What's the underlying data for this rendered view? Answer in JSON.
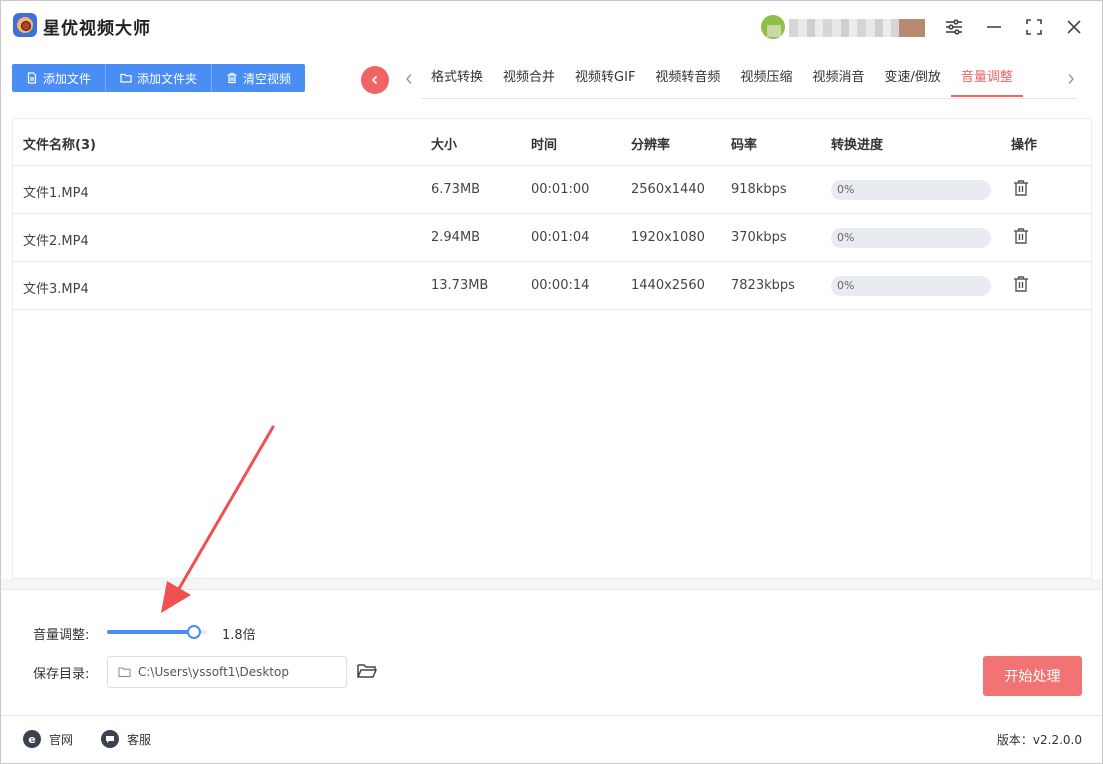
{
  "app": {
    "title": "星优视频大师"
  },
  "toolbar": {
    "add_file": "添加文件",
    "add_folder": "添加文件夹",
    "clear_videos": "清空视频"
  },
  "tabs": [
    {
      "label": "格式转换"
    },
    {
      "label": "视频合并"
    },
    {
      "label": "视频转GIF"
    },
    {
      "label": "视频转音频"
    },
    {
      "label": "视频压缩"
    },
    {
      "label": "视频消音"
    },
    {
      "label": "变速/倒放"
    },
    {
      "label": "音量调整",
      "active": true
    }
  ],
  "table": {
    "headers": {
      "name": "文件名称(3)",
      "size": "大小",
      "duration": "时间",
      "resolution": "分辨率",
      "bitrate": "码率",
      "progress": "转换进度",
      "actions": "操作"
    },
    "rows": [
      {
        "name": "文件1.MP4",
        "size": "6.73MB",
        "duration": "00:01:00",
        "resolution": "2560x1440",
        "bitrate": "918kbps",
        "progress": "0%",
        "progress_value": 0
      },
      {
        "name": "文件2.MP4",
        "size": "2.94MB",
        "duration": "00:01:04",
        "resolution": "1920x1080",
        "bitrate": "370kbps",
        "progress": "0%",
        "progress_value": 0
      },
      {
        "name": "文件3.MP4",
        "size": "13.73MB",
        "duration": "00:00:14",
        "resolution": "1440x2560",
        "bitrate": "7823kbps",
        "progress": "0%",
        "progress_value": 0
      }
    ]
  },
  "settings": {
    "volume_label": "音量调整:",
    "volume_value": "1.8倍",
    "volume_level": 0.87,
    "save_label": "保存目录:",
    "save_path": "C:\\Users\\yssoft1\\Desktop",
    "start_button": "开始处理"
  },
  "statusbar": {
    "website": "官网",
    "support": "客服",
    "version": "版本：v2.2.0.0"
  },
  "colors": {
    "primary": "#4a8ef4",
    "accent": "#f06464",
    "start_button": "#f27373"
  }
}
